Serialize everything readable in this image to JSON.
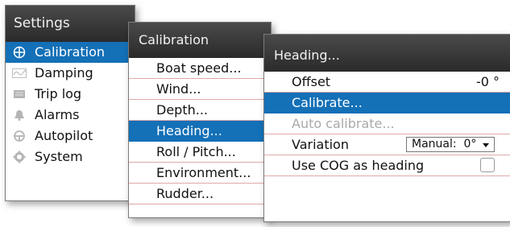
{
  "settings": {
    "title": "Settings",
    "items": [
      {
        "label": "Calibration",
        "icon": "calibration-crosshair-icon",
        "selected": true
      },
      {
        "label": "Damping",
        "icon": "damping-wave-icon"
      },
      {
        "label": "Trip log",
        "icon": "trip-log-icon"
      },
      {
        "label": "Alarms",
        "icon": "alarm-bell-icon"
      },
      {
        "label": "Autopilot",
        "icon": "autopilot-helm-icon"
      },
      {
        "label": "System",
        "icon": "system-gear-icon"
      }
    ]
  },
  "calibration": {
    "title": "Calibration",
    "items": [
      {
        "label": "Boat speed..."
      },
      {
        "label": "Wind..."
      },
      {
        "label": "Depth..."
      },
      {
        "label": "Heading...",
        "selected": true
      },
      {
        "label": "Roll / Pitch..."
      },
      {
        "label": "Environment..."
      },
      {
        "label": "Rudder..."
      }
    ]
  },
  "heading": {
    "title": "Heading...",
    "offset": {
      "label": "Offset",
      "value": "-0 °"
    },
    "calibrate": {
      "label": "Calibrate..."
    },
    "auto_calibrate": {
      "label": "Auto calibrate..."
    },
    "variation": {
      "label": "Variation",
      "selected_value": "Manual:  0°"
    },
    "use_cog": {
      "label": "Use COG as heading",
      "checked": false
    }
  },
  "colors": {
    "selection": "#1470b7",
    "header": "#333333",
    "divider": "#e0a9a9",
    "disabled_text": "#a9a9a9"
  }
}
